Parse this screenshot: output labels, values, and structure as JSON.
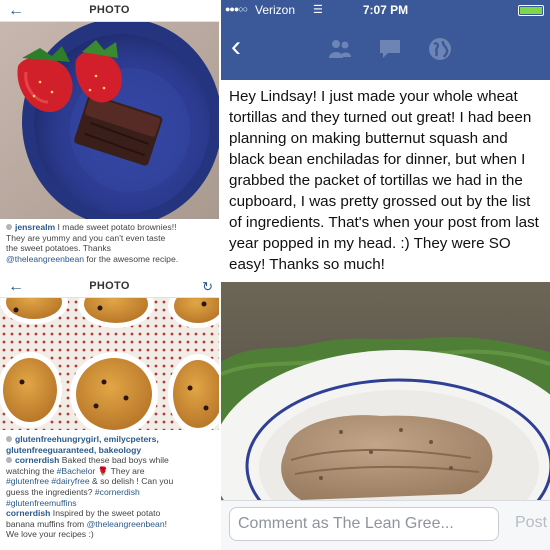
{
  "instagram_top": {
    "title": "PHOTO",
    "caption": {
      "username": "jensrealm",
      "line1": " I made sweet potato brownies!!",
      "line2": "They are yummy and you can't even taste",
      "line3": "the sweet potatoes. Thanks",
      "mention": "@theleangreenbean",
      "line4_tail": " for the awesome recipe."
    }
  },
  "instagram_bottom": {
    "title": "PHOTO",
    "likes": {
      "line1": "glutenfreehungrygirl, emilycpeters,",
      "line2": "glutenfreeguaranteed, bakeology"
    },
    "comments": [
      {
        "username": "cornerdish",
        "l1": " Baked these bad boys while",
        "l2a": "watching the ",
        "l2tag": "#Bachelor",
        "l2b": " 🌹 They are",
        "l3tag1": "#glutenfree",
        "l3amp": " ",
        "l3tag2": "#dairyfree",
        "l3b": " & so delish ! Can you",
        "l4a": "guess the ingredients? ",
        "l4tag": "#cornerdish",
        "l5tag": "#glutenfreemuffins"
      },
      {
        "username": "cornerdish",
        "l1": " Inspired by the sweet potato",
        "l2a": "banana muffins from ",
        "l2mention": "@theleangreenbean",
        "l2b": "!",
        "l3": "We love your recipes :)"
      }
    ]
  },
  "facebook": {
    "status_bar": {
      "signal": "●●●○○",
      "carrier": "Verizon",
      "time": "7:07 PM",
      "battery_level": 1.0
    },
    "post_text": "Hey Lindsay!  I just made your whole wheat tortillas and they turned out great!  I had been planning on making butternut squash and black bean enchiladas for dinner,  but when I grabbed the packet of tortillas we had in the cupboard, I was pretty grossed out by the list of ingredients.   That's when your post from last year popped in my head. :)   They were SO easy!  Thanks so much!",
    "comment_placeholder": "Comment as The Lean Gree...",
    "post_button": "Post"
  },
  "colors": {
    "facebook_blue": "#3b5998",
    "instagram_link": "#2b5a8a",
    "plate_blue": "#2f3f93"
  },
  "icons": {
    "instagram_back": "arrow-left-icon",
    "instagram_refresh": "refresh-icon",
    "facebook_back": "chevron-left-icon",
    "facebook_nav": [
      "friends-icon",
      "messages-icon",
      "globe-icon"
    ],
    "status": [
      "signal-icon",
      "wifi-icon",
      "battery-icon"
    ]
  }
}
